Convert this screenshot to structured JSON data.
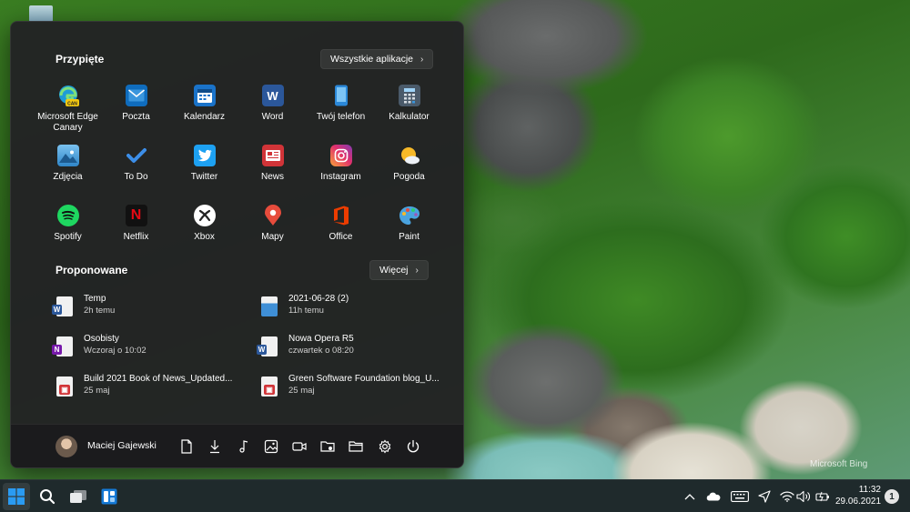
{
  "start_menu": {
    "pinned_title": "Przypięte",
    "all_apps_label": "Wszystkie aplikacje",
    "pinned": [
      {
        "label": "Microsoft Edge Canary",
        "icon": "edge-canary-icon"
      },
      {
        "label": "Poczta",
        "icon": "mail-icon"
      },
      {
        "label": "Kalendarz",
        "icon": "calendar-icon"
      },
      {
        "label": "Word",
        "icon": "word-icon"
      },
      {
        "label": "Twój telefon",
        "icon": "phone-icon"
      },
      {
        "label": "Kalkulator",
        "icon": "calculator-icon"
      },
      {
        "label": "Zdjęcia",
        "icon": "photos-icon"
      },
      {
        "label": "To Do",
        "icon": "todo-icon"
      },
      {
        "label": "Twitter",
        "icon": "twitter-icon"
      },
      {
        "label": "News",
        "icon": "news-icon"
      },
      {
        "label": "Instagram",
        "icon": "instagram-icon"
      },
      {
        "label": "Pogoda",
        "icon": "weather-icon"
      },
      {
        "label": "Spotify",
        "icon": "spotify-icon"
      },
      {
        "label": "Netflix",
        "icon": "netflix-icon"
      },
      {
        "label": "Xbox",
        "icon": "xbox-icon"
      },
      {
        "label": "Mapy",
        "icon": "maps-icon"
      },
      {
        "label": "Office",
        "icon": "office-icon"
      },
      {
        "label": "Paint",
        "icon": "paint-icon"
      }
    ],
    "recommended_title": "Proponowane",
    "more_label": "Więcej",
    "recommended": [
      {
        "name": "Temp",
        "sub": "2h temu",
        "icon": "word-doc-icon"
      },
      {
        "name": "2021-06-28 (2)",
        "sub": "11h temu",
        "icon": "image-file-icon"
      },
      {
        "name": "Osobisty",
        "sub": "Wczoraj o 10:02",
        "icon": "onenote-file-icon"
      },
      {
        "name": "Nowa Opera R5",
        "sub": "czwartek o 08:20",
        "icon": "word-doc-icon"
      },
      {
        "name": "Build 2021 Book of News_Updated...",
        "sub": "25 maj",
        "icon": "pdf-file-icon"
      },
      {
        "name": "Green Software Foundation blog_U...",
        "sub": "25 maj",
        "icon": "pdf-file-icon"
      }
    ],
    "user_name": "Maciej Gajewski",
    "footer_icons": [
      "documents-icon",
      "downloads-icon",
      "music-icon",
      "pictures-icon",
      "videos-icon",
      "network-folder-icon",
      "file-explorer-icon",
      "settings-icon",
      "power-icon"
    ]
  },
  "taskbar": {
    "buttons": [
      "start-icon",
      "search-icon",
      "task-view-icon",
      "widgets-icon"
    ],
    "tray_icons": [
      "chevron-up-icon",
      "onedrive-icon",
      "keyboard-icon",
      "location-icon",
      "wifi-icon",
      "volume-icon",
      "battery-icon"
    ],
    "time": "11:32",
    "date": "29.06.2021",
    "notification_count": "1"
  },
  "wallpaper": {
    "watermark": "Microsoft Bing"
  },
  "colors": {
    "menu_bg": "#232325",
    "taskbar_bg": "#1f2a2c",
    "accent": "#0a84ff"
  }
}
